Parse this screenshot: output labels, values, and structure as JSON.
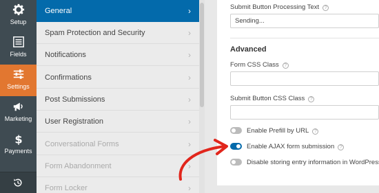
{
  "rail": {
    "items": [
      {
        "label": "Setup",
        "icon": "gear-icon"
      },
      {
        "label": "Fields",
        "icon": "list-icon"
      },
      {
        "label": "Settings",
        "icon": "sliders-icon",
        "active": true
      },
      {
        "label": "Marketing",
        "icon": "megaphone-icon"
      },
      {
        "label": "Payments",
        "icon": "dollar-icon"
      }
    ],
    "footer_icon": "history-icon"
  },
  "sections": [
    {
      "label": "General",
      "active": true
    },
    {
      "label": "Spam Protection and Security"
    },
    {
      "label": "Notifications"
    },
    {
      "label": "Confirmations"
    },
    {
      "label": "Post Submissions"
    },
    {
      "label": "User Registration"
    },
    {
      "label": "Conversational Forms",
      "disabled": true
    },
    {
      "label": "Form Abandonment",
      "disabled": true
    },
    {
      "label": "Form Locker",
      "disabled": true
    }
  ],
  "settings": {
    "processing_text": {
      "label": "Submit Button Processing Text",
      "value": "Sending..."
    },
    "advanced_heading": "Advanced",
    "css_class": {
      "label": "Form CSS Class",
      "value": ""
    },
    "button_css_class": {
      "label": "Submit Button CSS Class",
      "value": ""
    },
    "toggles": [
      {
        "label": "Enable Prefill by URL",
        "on": false
      },
      {
        "label": "Enable AJAX form submission",
        "on": true
      },
      {
        "label": "Disable storing entry information in WordPress",
        "on": false
      }
    ]
  },
  "colors": {
    "rail_bg": "#3f4b52",
    "accent_orange": "#e27730",
    "active_blue": "#036aab",
    "arrow_red": "#e1261c"
  }
}
